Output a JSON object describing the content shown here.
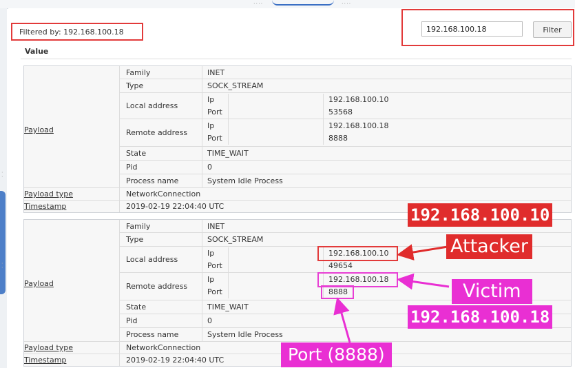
{
  "filter": {
    "status_text": "Filtered by: 192.168.100.18",
    "input_value": "192.168.100.18",
    "button_label": "Filter"
  },
  "value_header": "Value",
  "records": [
    {
      "payload_label": "Payload",
      "family_label": "Family",
      "family_value": "INET",
      "type_label": "Type",
      "type_value": "SOCK_STREAM",
      "local_label": "Local address",
      "local_ip_label": "Ip",
      "local_ip": "192.168.100.10",
      "local_port_label": "Port",
      "local_port": "53568",
      "remote_label": "Remote address",
      "remote_ip_label": "Ip",
      "remote_ip": "192.168.100.18",
      "remote_port_label": "Port",
      "remote_port": "8888",
      "state_label": "State",
      "state_value": "TIME_WAIT",
      "pid_label": "Pid",
      "pid_value": "0",
      "process_label": "Process name",
      "process_value": "System Idle Process",
      "payload_type_label": "Payload type",
      "payload_type_value": "NetworkConnection",
      "timestamp_label": "Timestamp",
      "timestamp_value": "2019-02-19 22:04:40 UTC"
    },
    {
      "payload_label": "Payload",
      "family_label": "Family",
      "family_value": "INET",
      "type_label": "Type",
      "type_value": "SOCK_STREAM",
      "local_label": "Local address",
      "local_ip_label": "Ip",
      "local_ip": "192.168.100.10",
      "local_port_label": "Port",
      "local_port": "49654",
      "remote_label": "Remote address",
      "remote_ip_label": "Ip",
      "remote_ip": "192.168.100.18",
      "remote_port_label": "Port",
      "remote_port": "8888",
      "state_label": "State",
      "state_value": "TIME_WAIT",
      "pid_label": "Pid",
      "pid_value": "0",
      "process_label": "Process name",
      "process_value": "System Idle Process",
      "payload_type_label": "Payload type",
      "payload_type_value": "NetworkConnection",
      "timestamp_label": "Timestamp",
      "timestamp_value": "2019-02-19 22:04:40 UTC"
    }
  ],
  "annotations": {
    "attacker_ip": "192.168.100.10",
    "attacker_label": "Attacker",
    "victim_label": "Victim",
    "victim_ip": "192.168.100.18",
    "port_label": "Port (8888)",
    "colors": {
      "attacker": "#e02c2c",
      "victim": "#e92fd3"
    }
  }
}
